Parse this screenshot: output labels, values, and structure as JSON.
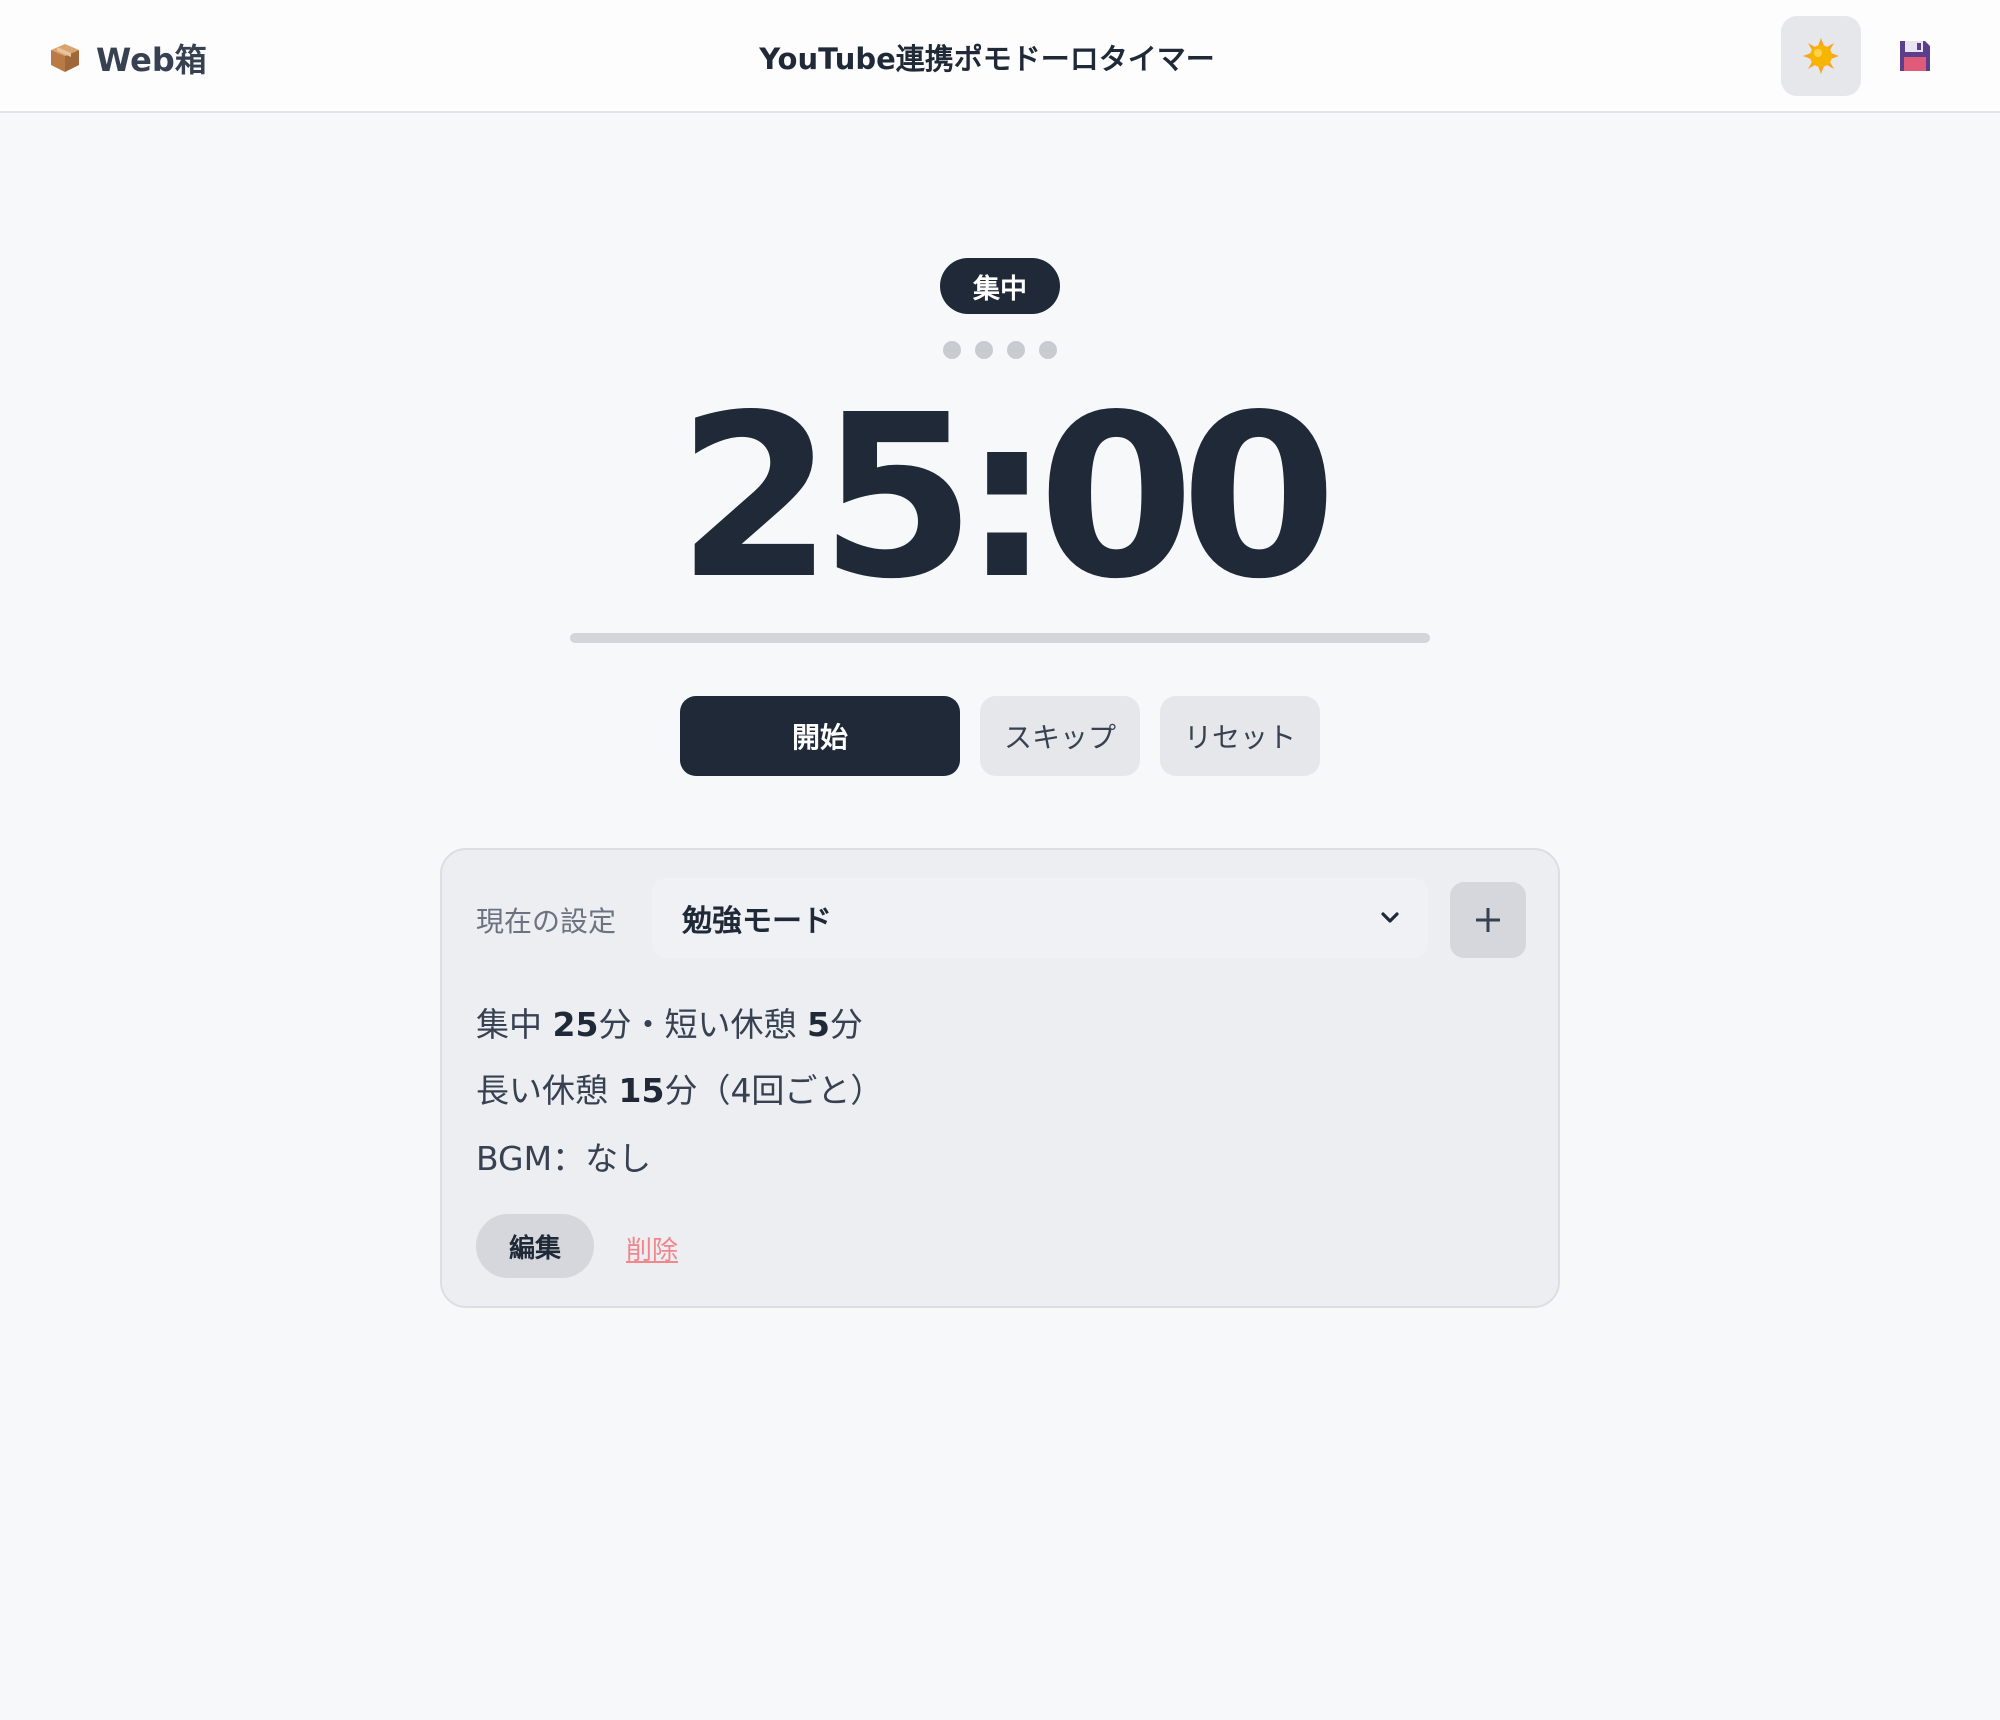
{
  "header": {
    "brand_name": "Web箱",
    "title": "YouTube連携ポモドーロタイマー",
    "theme_icon": "sun-icon",
    "save_icon": "floppy-disk-icon"
  },
  "timer": {
    "mode": "集中",
    "cycle_dots": 4,
    "completed_cycles": 0,
    "time": "25:00",
    "progress": 0
  },
  "controls": {
    "start": "開始",
    "skip": "スキップ",
    "reset": "リセット"
  },
  "settings": {
    "label": "現在の設定",
    "selected_preset": "勉強モード",
    "line1": {
      "focus_label": "集中 ",
      "focus_value": "25",
      "focus_unit": "分・短い休憩 ",
      "short_value": "5",
      "short_unit": "分"
    },
    "line2": {
      "long_label": "長い休憩 ",
      "long_value": "15",
      "long_suffix": "分（4回ごと）"
    },
    "line3": "BGM：なし",
    "edit": "編集",
    "delete": "削除"
  },
  "colors": {
    "primary": "#1f2937",
    "danger": "#f0878d",
    "background": "#f7f8fa"
  }
}
